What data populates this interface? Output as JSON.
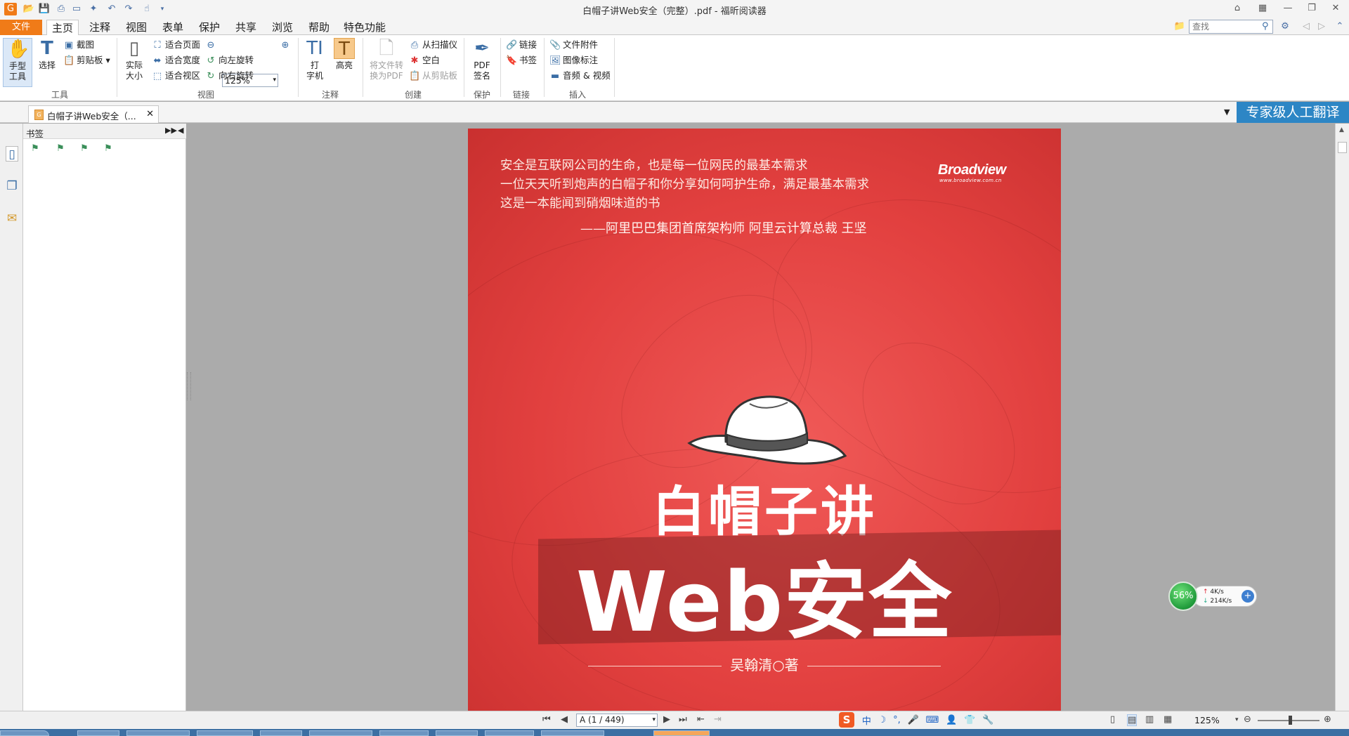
{
  "window": {
    "title": "白帽子讲Web安全（完整）.pdf - 福昕阅读器"
  },
  "menu": {
    "file": "文件",
    "tabs": [
      "主页",
      "注释",
      "视图",
      "表单",
      "保护",
      "共享",
      "浏览",
      "帮助",
      "特色功能"
    ],
    "active_tab": "主页"
  },
  "search": {
    "placeholder": "查找"
  },
  "ribbon": {
    "tools": {
      "hand": "手型\n工具",
      "select": "选择",
      "snapshot": "截图",
      "clipboard": "剪贴板",
      "group": "工具"
    },
    "view": {
      "actual_size": "实际\n大小",
      "fit_page": "适合页面",
      "fit_width": "适合宽度",
      "fit_visible": "适合视区",
      "rotate_left": "向左旋转",
      "rotate_right": "向右旋转",
      "zoom": "125%",
      "group": "视图"
    },
    "annotate": {
      "typewriter": "打\n字机",
      "highlight": "高亮",
      "group": "注释"
    },
    "create": {
      "convert": "将文件转\n换为PDF",
      "from_scanner": "从扫描仪",
      "blank": "空白",
      "from_clipboard": "从剪贴板",
      "group": "创建"
    },
    "protect": {
      "pdf_sign": "PDF\n签名",
      "group": "保护"
    },
    "links": {
      "link": "链接",
      "bookmark": "书签",
      "group": "链接"
    },
    "insert": {
      "attachment": "文件附件",
      "image_annot": "图像标注",
      "audio_video": "音频 & 视频",
      "group": "插入"
    }
  },
  "doc_tab": {
    "label": "白帽子讲Web安全（..."
  },
  "translate_button": "专家级人工翻译",
  "bookmark_panel": {
    "title": "书签"
  },
  "cover": {
    "quote_lines": [
      "安全是互联网公司的生命，也是每一位网民的最基本需求",
      "一位天天听到炮声的白帽子和你分享如何呵护生命，满足最基本需求",
      "这是一本能闻到硝烟味道的书"
    ],
    "quote_author": "——阿里巴巴集团首席架构师 阿里云计算总裁  王坚",
    "publisher": "Broadview",
    "publisher_url": "www.broadview.com.cn",
    "title_line1": "白帽子讲",
    "title_line2": "Web安全",
    "author": "吴翰清○著"
  },
  "net_widget": {
    "percent": "56%",
    "upload": "4K/s",
    "download": "214K/s"
  },
  "statusbar": {
    "page": "A (1 / 449)",
    "zoom": "125%"
  }
}
